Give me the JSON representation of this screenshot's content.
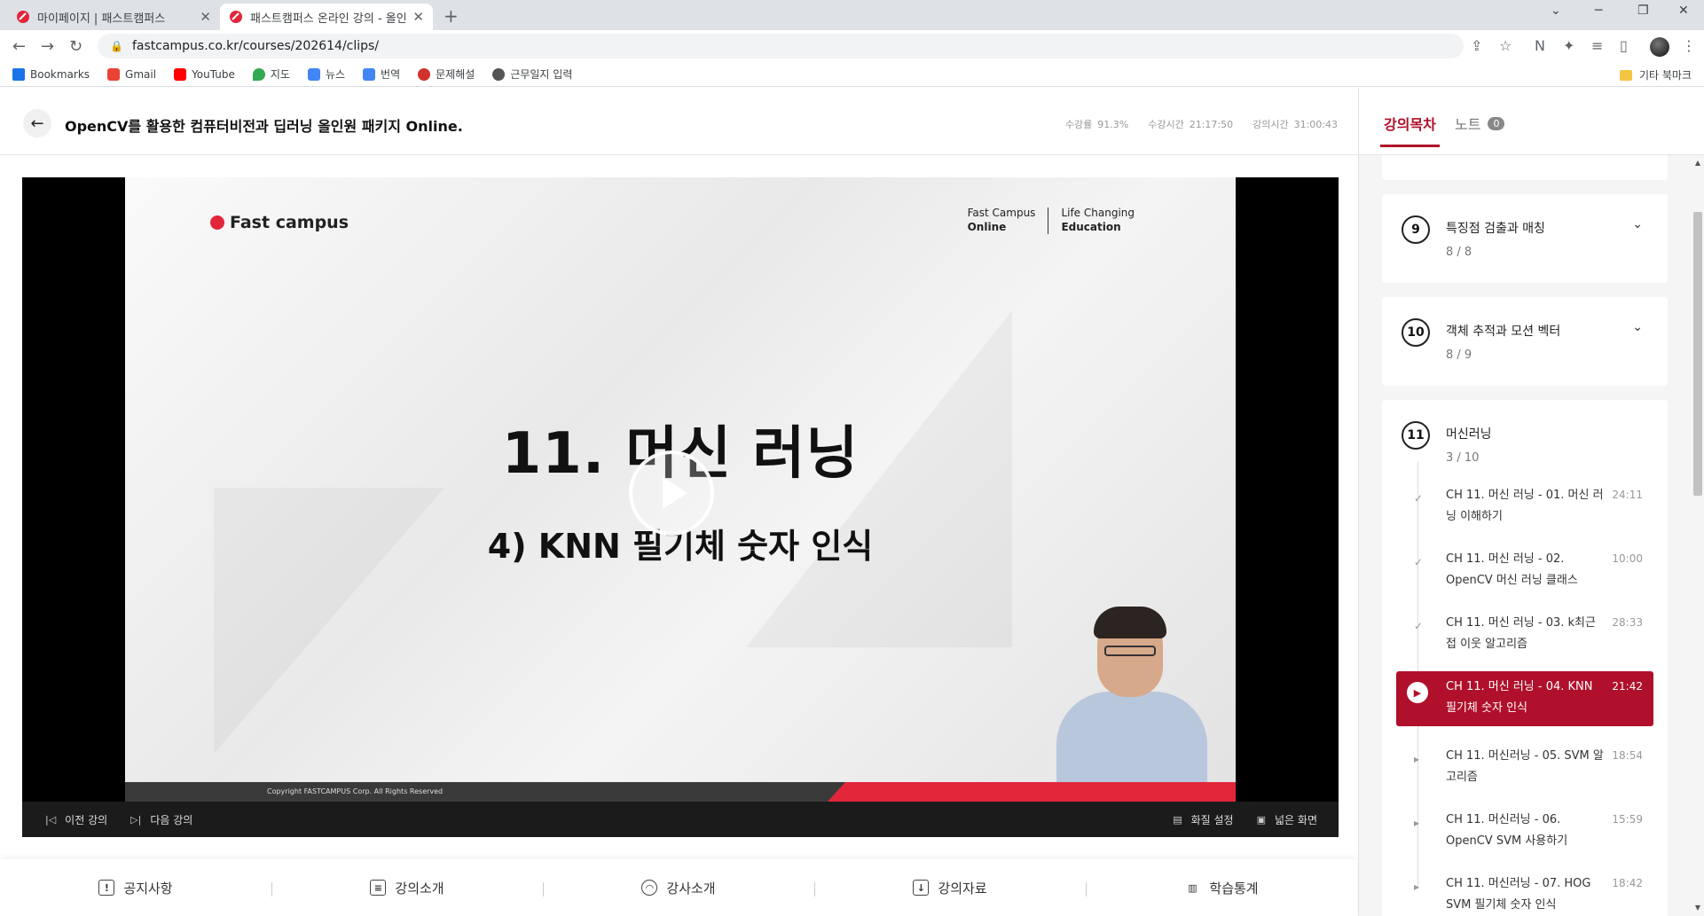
{
  "browser": {
    "tabs": [
      {
        "title": "마이페이지 | 패스트캠퍼스",
        "active": false
      },
      {
        "title": "패스트캠퍼스 온라인 강의 - 올인",
        "active": true
      }
    ],
    "url": "fastcampus.co.kr/courses/202614/clips/",
    "bookmarks": [
      "Bookmarks",
      "Gmail",
      "YouTube",
      "지도",
      "뉴스",
      "번역",
      "문제해설",
      "근무일지 입력"
    ],
    "other_bookmarks": "기타 북마크"
  },
  "header": {
    "course_title": "OpenCV를 활용한 컴퓨터비전과 딥러닝 올인원 패키지 Online.",
    "stats": [
      {
        "label": "수강률",
        "value": "91.3%"
      },
      {
        "label": "수강시간",
        "value": "21:17:50"
      },
      {
        "label": "강의시간",
        "value": "31:00:43"
      }
    ]
  },
  "video": {
    "brand": "Fast campus",
    "brand_right_1a": "Fast Campus",
    "brand_right_1b": "Online",
    "brand_right_2a": "Life Changing",
    "brand_right_2b": "Education",
    "slide_title": "11. 머신 러닝",
    "slide_subtitle": "4) KNN 필기체 숫자 인식",
    "copyright": "Copyright FASTCAMPUS Corp. All Rights Reserved",
    "controls": {
      "prev": "이전 강의",
      "next": "다음 강의",
      "quality": "화질 설정",
      "wide": "넓은 화면"
    }
  },
  "bottom_tabs": [
    "공지사항",
    "강의소개",
    "강사소개",
    "강의자료",
    "학습통계"
  ],
  "sidebar": {
    "tab_toc": "강의목차",
    "tab_note": "노트",
    "note_count": "0",
    "chapters": [
      {
        "num": "9",
        "title": "특징점 검출과 매칭",
        "progress": "8 / 8"
      },
      {
        "num": "10",
        "title": "객체 추적과 모션 벡터",
        "progress": "8 / 9"
      },
      {
        "num": "11",
        "title": "머신러닝",
        "progress": "3 / 10"
      }
    ],
    "lessons": [
      {
        "title": "CH 11. 머신 러닝 - 01. 머신 러닝 이해하기",
        "duration": "24:11",
        "state": "done"
      },
      {
        "title": "CH 11. 머신 러닝 - 02. OpenCV 머신 러닝 클래스",
        "duration": "10:00",
        "state": "done"
      },
      {
        "title": "CH 11. 머신 러닝 - 03. k최근접 이웃 알고리즘",
        "duration": "28:33",
        "state": "done"
      },
      {
        "title": "CH 11. 머신 러닝 - 04. KNN 필기체 숫자 인식",
        "duration": "21:42",
        "state": "current"
      },
      {
        "title": "CH 11. 머신러닝 - 05. SVM 알고리즘",
        "duration": "18:54",
        "state": "todo"
      },
      {
        "title": "CH 11. 머신러닝 - 06. OpenCV SVM 사용하기",
        "duration": "15:59",
        "state": "todo"
      },
      {
        "title": "CH 11. 머신러닝 - 07. HOG SVM 필기체 숫자 인식",
        "duration": "18:42",
        "state": "todo"
      }
    ]
  },
  "colors": {
    "accent": "#b0102b",
    "brand_red": "#e2263a"
  }
}
